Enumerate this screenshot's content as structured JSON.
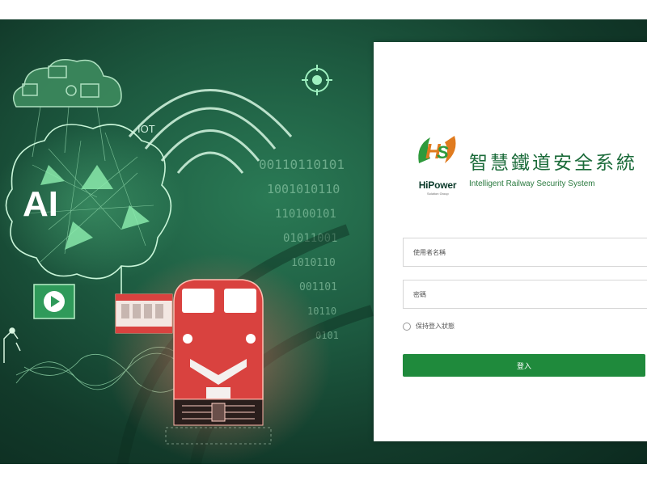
{
  "login": {
    "brand_name": "HiPower",
    "brand_tagline": "Solution Group",
    "system_title": "智慧鐵道安全系統",
    "system_subtitle": "Intelligent Railway Security System",
    "username_placeholder": "使用者名稱",
    "password_placeholder": "密碼",
    "remember_label": "保持登入狀態",
    "login_button": "登入"
  },
  "illustration": {
    "ai_label": "AI",
    "iot_label": "IOT",
    "binary_rows": [
      "00110110101",
      "1001010110",
      "110100101",
      "01011001",
      "1010110",
      "001101",
      "10110",
      "0101"
    ]
  },
  "colors": {
    "accent": "#1f8a3c",
    "title_green": "#1b6b3a",
    "train_red": "#d9423f",
    "background_dark": "#123a2a"
  }
}
